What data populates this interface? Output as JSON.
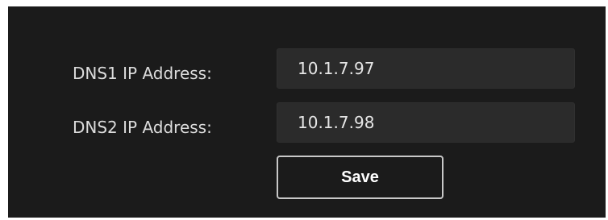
{
  "dns1": {
    "label": "DNS1 IP Address:",
    "value": "10.1.7.97"
  },
  "dns2": {
    "label": "DNS2 IP Address:",
    "value": "10.1.7.98"
  },
  "actions": {
    "save_label": "Save"
  }
}
